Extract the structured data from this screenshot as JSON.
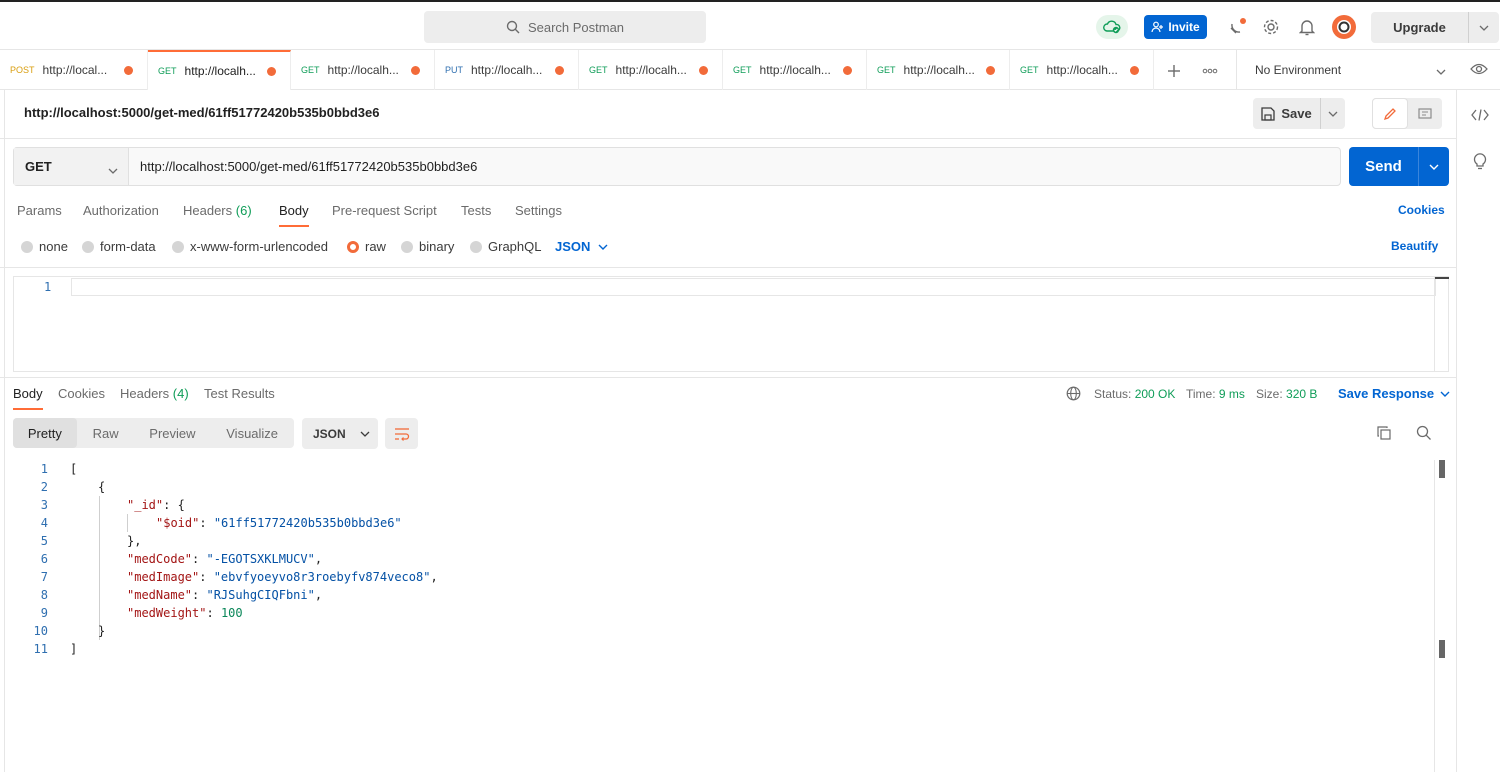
{
  "topbar": {
    "search_placeholder": "Search Postman",
    "invite_label": "Invite",
    "upgrade_label": "Upgrade"
  },
  "tabs": [
    {
      "method": "POST",
      "url": "http://local...",
      "method_color": "#d99e0f"
    },
    {
      "method": "GET",
      "url": "http://localh...",
      "method_color": "#0f9d58"
    },
    {
      "method": "GET",
      "url": "http://localh...",
      "method_color": "#0f9d58"
    },
    {
      "method": "PUT",
      "url": "http://localh...",
      "method_color": "#2f6fb0"
    },
    {
      "method": "GET",
      "url": "http://localh...",
      "method_color": "#0f9d58"
    },
    {
      "method": "GET",
      "url": "http://localh...",
      "method_color": "#0f9d58"
    },
    {
      "method": "GET",
      "url": "http://localh...",
      "method_color": "#0f9d58"
    },
    {
      "method": "GET",
      "url": "http://localh...",
      "method_color": "#0f9d58"
    }
  ],
  "environment": {
    "selected": "No Environment"
  },
  "request": {
    "title": "http://localhost:5000/get-med/61ff51772420b535b0bbd3e6",
    "save_label": "Save",
    "method": "GET",
    "url": "http://localhost:5000/get-med/61ff51772420b535b0bbd3e6",
    "send_label": "Send",
    "tabs": {
      "params": "Params",
      "authorization": "Authorization",
      "headers": "Headers",
      "headers_count": "(6)",
      "body": "Body",
      "prerequest": "Pre-request Script",
      "tests": "Tests",
      "settings": "Settings"
    },
    "cookies_label": "Cookies",
    "body_modes": {
      "none": "none",
      "form_data": "form-data",
      "urlencoded": "x-www-form-urlencoded",
      "raw": "raw",
      "binary": "binary",
      "graphql": "GraphQL"
    },
    "raw_format": "JSON",
    "beautify_label": "Beautify",
    "editor_line": "1"
  },
  "response": {
    "tabs": {
      "body": "Body",
      "cookies": "Cookies",
      "headers": "Headers",
      "headers_count": "(4)",
      "test_results": "Test Results"
    },
    "status_label": "Status:",
    "status_value": "200 OK",
    "time_label": "Time:",
    "time_value": "9 ms",
    "size_label": "Size:",
    "size_value": "320 B",
    "save_response_label": "Save Response",
    "views": {
      "pretty": "Pretty",
      "raw": "Raw",
      "preview": "Preview",
      "visualize": "Visualize"
    },
    "format": "JSON",
    "body": {
      "oid": "\"61ff51772420b535b0bbd3e6\"",
      "medCode": "\"-EGOTSXKLMUCV\"",
      "medImage": "\"ebvfyoeyvo8r3roebyfv874veco8\"",
      "medName": "\"RJSuhgCIQFbni\"",
      "medWeight": "100"
    },
    "line_numbers": [
      "1",
      "2",
      "3",
      "4",
      "5",
      "6",
      "7",
      "8",
      "9",
      "10",
      "11"
    ]
  }
}
